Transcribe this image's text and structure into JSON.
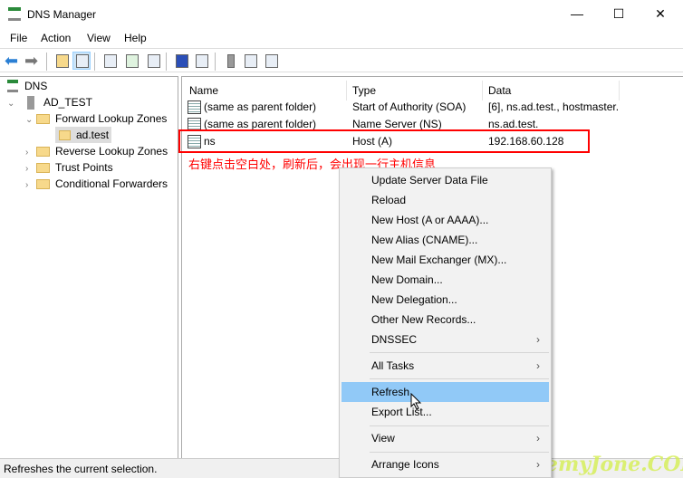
{
  "window": {
    "title": "DNS Manager",
    "minimize": "—",
    "maximize": "☐",
    "close": "✕"
  },
  "menubar": [
    "File",
    "Action",
    "View",
    "Help"
  ],
  "toolbar": [
    "back-icon",
    "forward-icon",
    "up-folder-icon",
    "show-hide-console-tree-icon",
    "properties-icon",
    "refresh-icon",
    "export-list-icon",
    "help-icon",
    "action-pane-icon",
    "server-icon",
    "zone-icon",
    "record-icon"
  ],
  "tree": {
    "root": "DNS",
    "server": "AD_TEST",
    "forward": "Forward Lookup Zones",
    "zone": "ad.test",
    "reverse": "Reverse Lookup Zones",
    "trust": "Trust Points",
    "conditional": "Conditional Forwarders"
  },
  "list": {
    "headers": [
      "Name",
      "Type",
      "Data"
    ],
    "rows": [
      {
        "name": "(same as parent folder)",
        "type": "Start of Authority (SOA)",
        "data": "[6], ns.ad.test., hostmaster."
      },
      {
        "name": "(same as parent folder)",
        "type": "Name Server (NS)",
        "data": "ns.ad.test."
      },
      {
        "name": "ns",
        "type": "Host (A)",
        "data": "192.168.60.128"
      }
    ]
  },
  "annotation": "右键点击空白处，刷新后，会出现一行主机信息",
  "annotation_color": "#ff0000",
  "context_menu": [
    "Update Server Data File",
    "Reload",
    "New Host (A or AAAA)...",
    "New Alias (CNAME)...",
    "New Mail Exchanger (MX)...",
    "New Domain...",
    "New Delegation...",
    "Other New Records...",
    "DNSSEC",
    "All Tasks",
    "Refresh",
    "Export List...",
    "View",
    "Arrange Icons"
  ],
  "submenu_arrow": "›",
  "highlight_color": "#91c9f7",
  "status": "Refreshes the current selection.",
  "watermark": "JeremyJone.COM"
}
